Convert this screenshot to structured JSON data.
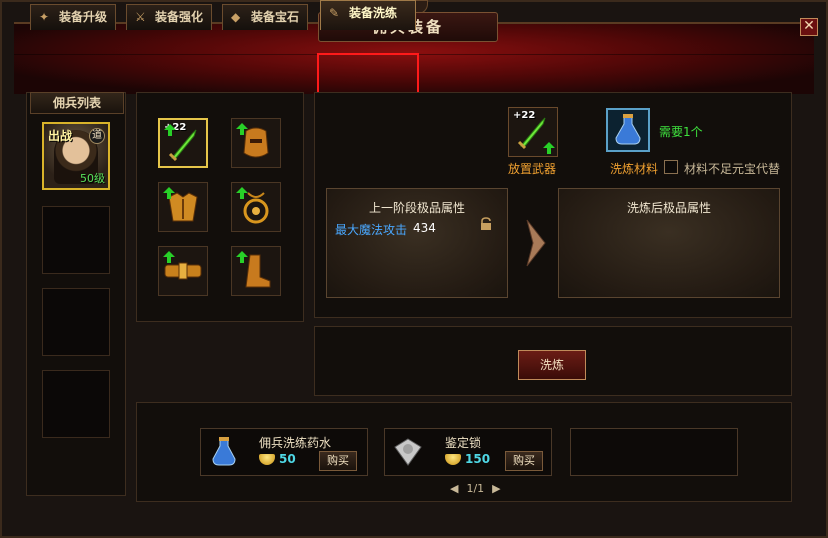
{
  "window": {
    "title": "佣兵装备",
    "close_label": "✕"
  },
  "tabs": [
    {
      "label": "装备升级",
      "icon": "upgrade-icon"
    },
    {
      "label": "装备强化",
      "icon": "sword-icon"
    },
    {
      "label": "装备宝石",
      "icon": "gem-icon"
    },
    {
      "label": "装备洗练",
      "icon": "scroll-icon",
      "active": true
    }
  ],
  "mercenary_list": {
    "title": "佣兵列表",
    "active": {
      "status": "出战",
      "badge": "道",
      "level": "50级"
    }
  },
  "equipment": {
    "selected_plus": "+22"
  },
  "refine": {
    "weapon_plus": "+22",
    "weapon_label": "放置武器",
    "material_label": "洗炼材料",
    "need_label": "需要1个",
    "substitute_label": "材料不足元宝代替",
    "prev_attrs_title": "上一阶段极品属性",
    "attr_name": "最大魔法攻击",
    "attr_value": "434",
    "after_attrs_title": "洗炼后极品属性",
    "refine_button": "洗炼"
  },
  "shop": {
    "items": [
      {
        "name": "佣兵洗练药水",
        "price": "50",
        "buy": "购买"
      },
      {
        "name": "鉴定锁",
        "price": "150",
        "buy": "购买"
      }
    ],
    "pager": {
      "prev": "◀",
      "page": "1/1",
      "next": "▶"
    }
  },
  "colors": {
    "highlight": "#ff1a1a",
    "accent_gold": "#e6c64a",
    "green": "#3ee23e",
    "blue_attr": "#4aa8ff"
  }
}
